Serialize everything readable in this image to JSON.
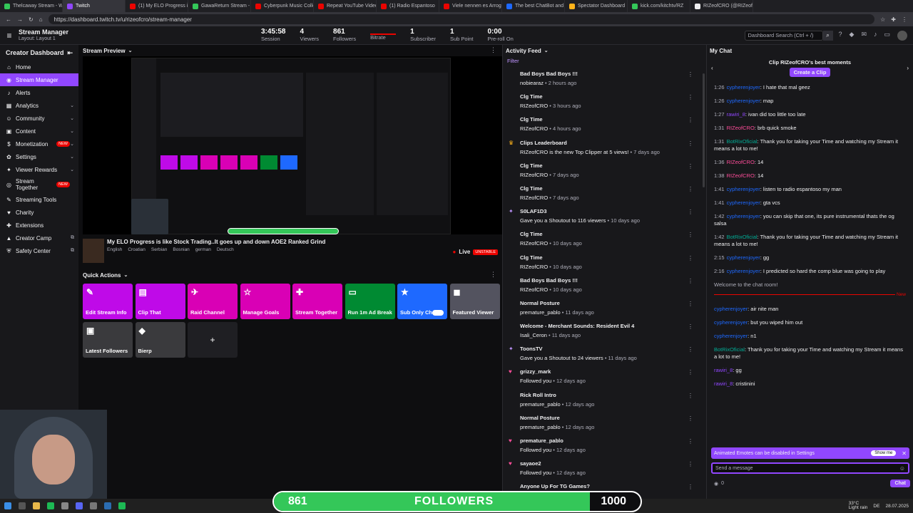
{
  "browser": {
    "tabs": [
      {
        "label": "Thelcaway Stream - Wa",
        "color": "#34c759",
        "active": false
      },
      {
        "label": "Twitch",
        "color": "#9147ff",
        "active": true
      },
      {
        "label": "(1) My ELO Progress is I",
        "color": "#eb0400",
        "active": false
      },
      {
        "label": "GawaReturn Stream - W",
        "color": "#34c759",
        "active": false
      },
      {
        "label": "Cyberpunk Music Collec",
        "color": "#eb0400",
        "active": false
      },
      {
        "label": "Repeat YouTube Videos",
        "color": "#eb0400",
        "active": false
      },
      {
        "label": "(1) Radio Espantoso",
        "color": "#eb0400",
        "active": false
      },
      {
        "label": "Viele nennen es Arroga",
        "color": "#eb0400",
        "active": false
      },
      {
        "label": "The best ChatBot and",
        "color": "#1e69ff",
        "active": false
      },
      {
        "label": "Spectator Dashboard",
        "color": "#ffb31a",
        "active": false
      },
      {
        "label": "kick.com/kitchtv/RZ",
        "color": "#34c759",
        "active": false
      },
      {
        "label": "RIZeofCRO (@RIZeofCR",
        "color": "#efeff1",
        "active": false
      }
    ],
    "url": "https://dashboard.twitch.tv/u/rizeofcro/stream-manager"
  },
  "topnav": {
    "title": "Stream Manager",
    "subtitle": "Layout: Layout 1",
    "stats": [
      {
        "value": "3:45:58",
        "label": "Session"
      },
      {
        "value": "4",
        "label": "Viewers"
      },
      {
        "value": "861",
        "label": "Followers"
      },
      {
        "value": "",
        "label": "Bitrate"
      },
      {
        "value": "1",
        "label": "Subscriber"
      },
      {
        "value": "1",
        "label": "Sub Point"
      },
      {
        "value": "0:00",
        "label": "Pre-roll On"
      }
    ],
    "search_placeholder": "Dashboard Search (Ctrl + /)"
  },
  "sidebar": {
    "title": "Creator Dashboard",
    "items": [
      {
        "label": "Home",
        "icon": "home-icon",
        "glyph": "⌂",
        "chevron": false,
        "badge": "",
        "external": false
      },
      {
        "label": "Stream Manager",
        "icon": "broadcast-icon",
        "glyph": "◉",
        "chevron": false,
        "badge": "",
        "external": false
      },
      {
        "label": "Alerts",
        "icon": "bell-icon",
        "glyph": "♪",
        "chevron": false,
        "badge": "",
        "external": false
      },
      {
        "label": "Analytics",
        "icon": "chart-icon",
        "glyph": "▦",
        "chevron": true,
        "badge": "",
        "external": false
      },
      {
        "label": "Community",
        "icon": "people-icon",
        "glyph": "☺",
        "chevron": true,
        "badge": "",
        "external": false
      },
      {
        "label": "Content",
        "icon": "film-icon",
        "glyph": "▣",
        "chevron": true,
        "badge": "",
        "external": false
      },
      {
        "label": "Monetization",
        "icon": "coin-icon",
        "glyph": "$",
        "chevron": true,
        "badge": "NEW",
        "external": false
      },
      {
        "label": "Settings",
        "icon": "gear-icon",
        "glyph": "✿",
        "chevron": true,
        "badge": "",
        "external": false
      },
      {
        "label": "Viewer Rewards",
        "icon": "gift-icon",
        "glyph": "✦",
        "chevron": true,
        "badge": "",
        "external": false
      },
      {
        "label": "Stream Together",
        "icon": "together-icon",
        "glyph": "◎",
        "chevron": false,
        "badge": "NEW",
        "external": false
      },
      {
        "label": "Streaming Tools",
        "icon": "tools-icon",
        "glyph": "✎",
        "chevron": false,
        "badge": "",
        "external": false
      },
      {
        "label": "Charity",
        "icon": "heart-icon",
        "glyph": "♥",
        "chevron": false,
        "badge": "",
        "external": false
      },
      {
        "label": "Extensions",
        "icon": "puzzle-icon",
        "glyph": "✚",
        "chevron": false,
        "badge": "",
        "external": false
      },
      {
        "label": "Creator Camp",
        "icon": "camp-icon",
        "glyph": "▲",
        "chevron": false,
        "badge": "",
        "external": true
      },
      {
        "label": "Safety Center",
        "icon": "shield-icon",
        "glyph": "⛨",
        "chevron": false,
        "badge": "",
        "external": true
      }
    ]
  },
  "preview": {
    "header": "Stream Preview",
    "title": "My ELO Progress is like Stock Trading..It goes up and down AOE2 Ranked Grind",
    "tags": [
      "English",
      "Croatian",
      "Serbian",
      "Bosnian",
      "german",
      "Deutsch"
    ],
    "live": "Live",
    "status": "UNSTABLE"
  },
  "quick_actions": {
    "header": "Quick Actions",
    "add_label": "+",
    "items": [
      {
        "label": "Edit Stream Info",
        "color": "#bf0ae8",
        "icon": "pencil-icon",
        "glyph": "✎"
      },
      {
        "label": "Clip That",
        "color": "#bf0ae8",
        "icon": "clip-icon",
        "glyph": "▤"
      },
      {
        "label": "Raid Channel",
        "color": "#d900b5",
        "icon": "raid-icon",
        "glyph": "✈"
      },
      {
        "label": "Manage Goals",
        "color": "#d900b5",
        "icon": "star-icon",
        "glyph": "☆"
      },
      {
        "label": "Stream Together",
        "color": "#d900b5",
        "icon": "add-person-icon",
        "glyph": "✚"
      },
      {
        "label": "Run 1m Ad Break",
        "color": "#008a32",
        "icon": "ad-icon",
        "glyph": "▭"
      },
      {
        "label": "Sub Only Chat",
        "color": "#1e69ff",
        "icon": "sub-star-icon",
        "glyph": "★"
      },
      {
        "label": "Featured Viewer",
        "color": "#53535f",
        "icon": "featured-icon",
        "glyph": "◼"
      },
      {
        "label": "Latest Followers",
        "color": "#3a3a3d",
        "icon": "followers-icon",
        "glyph": "▣"
      },
      {
        "label": "Bierp",
        "color": "#3a3a3d",
        "icon": "bierp-icon",
        "glyph": "◆"
      }
    ]
  },
  "activity": {
    "header": "Activity Feed",
    "filter": "Filter",
    "items": [
      {
        "title": "Bad Boys Bad Boys !!!",
        "user": "nobiearaz",
        "time": "2 hours ago",
        "icon": "",
        "glyph": ""
      },
      {
        "title": "Clg Time",
        "user": "RIZeofCRO",
        "time": "3 hours ago",
        "icon": "",
        "glyph": ""
      },
      {
        "title": "Clg Time",
        "user": "RIZeofCRO",
        "time": "4 hours ago",
        "icon": "",
        "glyph": ""
      },
      {
        "title": "Clips Leaderboard",
        "user": "RIZeofCRO is the new Top Clipper at 5 views!",
        "time": "7 days ago",
        "icon": "trophy-icon",
        "glyph": "♛"
      },
      {
        "title": "Clg Time",
        "user": "RIZeofCRO",
        "time": "7 days ago",
        "icon": "",
        "glyph": ""
      },
      {
        "title": "Clg Time",
        "user": "RIZeofCRO",
        "time": "7 days ago",
        "icon": "",
        "glyph": ""
      },
      {
        "title": "S0LAF1D3",
        "user": "Gave you a Shoutout to 116 viewers",
        "time": "10 days ago",
        "icon": "shoutout-icon",
        "glyph": "✦"
      },
      {
        "title": "Clg Time",
        "user": "RIZeofCRO",
        "time": "10 days ago",
        "icon": "",
        "glyph": ""
      },
      {
        "title": "Clg Time",
        "user": "RIZeofCRO",
        "time": "10 days ago",
        "icon": "",
        "glyph": ""
      },
      {
        "title": "Bad Boys Bad Boys !!!",
        "user": "RIZeofCRO",
        "time": "10 days ago",
        "icon": "",
        "glyph": ""
      },
      {
        "title": "Normal Posture",
        "user": "premature_pablo",
        "time": "11 days ago",
        "icon": "",
        "glyph": ""
      },
      {
        "title": "Welcome - Merchant Sounds: Resident Evil 4",
        "user": "Isali_Ceron",
        "time": "11 days ago",
        "icon": "",
        "glyph": ""
      },
      {
        "title": "ToonsTV",
        "user": "Gave you a Shoutout to 24 viewers",
        "time": "11 days ago",
        "icon": "shoutout-icon",
        "glyph": "✦"
      },
      {
        "title": "grizzy_mark",
        "user": "Followed you",
        "time": "12 days ago",
        "icon": "heart-icon",
        "glyph": "♥"
      },
      {
        "title": "Rick Roll Intro",
        "user": "premature_pablo",
        "time": "12 days ago",
        "icon": "",
        "glyph": ""
      },
      {
        "title": "Normal Posture",
        "user": "premature_pablo",
        "time": "12 days ago",
        "icon": "",
        "glyph": ""
      },
      {
        "title": "premature_pablo",
        "user": "Followed you",
        "time": "12 days ago",
        "icon": "heart-icon",
        "glyph": "♥"
      },
      {
        "title": "sayaoe2",
        "user": "Followed you",
        "time": "12 days ago",
        "icon": "heart-icon",
        "glyph": "♥"
      },
      {
        "title": "Anyone Up For TG Games?",
        "user": "",
        "time": "",
        "icon": "",
        "glyph": ""
      }
    ]
  },
  "chat": {
    "header": "My Chat",
    "clip_title": "Clip RIZeofCRO's best moments",
    "clip_button": "Create a Clip",
    "messages": [
      {
        "time": "1:26",
        "user": "cypherenjoyer",
        "ucls": "u",
        "text": ": I hate that mal geez"
      },
      {
        "time": "1:26",
        "user": "cypherenjoyer",
        "ucls": "u",
        "text": ": map"
      },
      {
        "time": "1:27",
        "user": "rawiri_8",
        "ucls": "u2",
        "text": ": ivan did too little too late"
      },
      {
        "time": "1:31",
        "user": "RIZeofCRO",
        "ucls": "u3",
        "text": ": brb quick smoke"
      },
      {
        "time": "1:31",
        "user": "BotRixOficial",
        "ucls": "u4",
        "text": ": Thank you for taking your Time and watching my Stream it means a lot to me!"
      },
      {
        "time": "1:36",
        "user": "RIZeofCRO",
        "ucls": "u3",
        "text": ": 14"
      },
      {
        "time": "1:38",
        "user": "RIZeofCRO",
        "ucls": "u3",
        "text": ": 14"
      },
      {
        "time": "1:41",
        "user": "cypherenjoyer",
        "ucls": "u",
        "text": ": listen to radio espantoso my man"
      },
      {
        "time": "1:41",
        "user": "cypherenjoyer",
        "ucls": "u",
        "text": ": gta vcs"
      },
      {
        "time": "1:42",
        "user": "cypherenjoyer",
        "ucls": "u",
        "text": ": you can skip that one, its pure instrumental thats the og salsa"
      },
      {
        "time": "1:42",
        "user": "BotRixOficial",
        "ucls": "u4",
        "text": ": Thank you for taking your Time and watching my Stream it means a lot to me!"
      },
      {
        "time": "2:15",
        "user": "cypherenjoyer",
        "ucls": "u",
        "text": ": gg"
      },
      {
        "time": "2:16",
        "user": "cypherenjoyer",
        "ucls": "u",
        "text": ": I predicted so hard the comp blue was going to play"
      }
    ],
    "welcome": "Welcome to the chat room!",
    "new_label": "New",
    "recent": [
      {
        "time": "",
        "user": "cypherenjoyer",
        "ucls": "u",
        "text": ": air nite man"
      },
      {
        "time": "",
        "user": "cypherenjoyer",
        "ucls": "u",
        "text": ": but you wiped him out"
      },
      {
        "time": "",
        "user": "cypherenjoyer",
        "ucls": "u",
        "text": ": n1"
      },
      {
        "time": "",
        "user": "BotRixOficial",
        "ucls": "u4",
        "text": ": Thank you for taking your Time and watching my Stream it means a lot to me!"
      },
      {
        "time": "",
        "user": "rawiri_8",
        "ucls": "u2",
        "text": ": gg"
      },
      {
        "time": "",
        "user": "rawiri_8",
        "ucls": "u2",
        "text": ": cristinini"
      }
    ],
    "notice": "Animated Emotes can be disabled in Settings",
    "notice_button": "Show me",
    "input_placeholder": "Send a message",
    "chat_button": "Chat",
    "points": "0"
  },
  "follower_goal": {
    "current": "861",
    "label": "FOLLOWERS",
    "target": "1000",
    "progress": 0.861
  },
  "taskbar": {
    "weather": "33°C",
    "weather_desc": "Light rain",
    "date": "28.07.2025",
    "lang": "DE"
  },
  "colors": {
    "accent": "#9147ff",
    "live": "#eb0400",
    "green": "#34c759"
  }
}
